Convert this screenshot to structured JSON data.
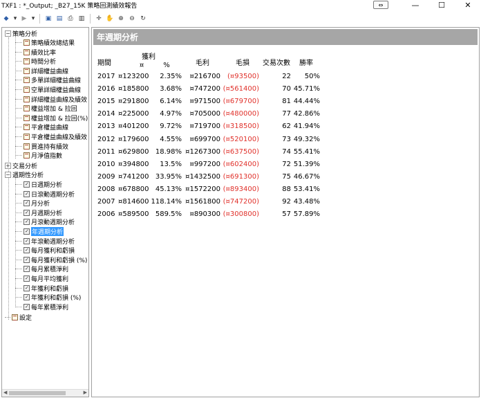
{
  "window": {
    "title": "TXF1 : *_Output; _B27_15K 策略回測績效報告",
    "restore_glyph": "⇔",
    "minimize_glyph": "—",
    "maximize_glyph": "☐",
    "close_glyph": "✕"
  },
  "toolbar": {
    "icons": [
      "back-icon",
      "forward-icon",
      "save-icon",
      "copy-icon",
      "print-icon",
      "preview-icon",
      "crosshair-icon",
      "hand-icon",
      "zoom-in-icon",
      "zoom-out-icon",
      "reset-icon"
    ],
    "glyphs": {
      "back": "◆",
      "back_drop": "▾",
      "forward": "▶",
      "forward_drop": "▾",
      "save": "▣",
      "copy": "▤",
      "print": "⎙",
      "preview": "▥",
      "crosshair": "✛",
      "hand": "✋",
      "zoom_in": "⊕",
      "zoom_out": "⊖",
      "reset": "↻"
    }
  },
  "tree": {
    "root_strategy": "策略分析",
    "strategy_items": [
      "策略績效總結果",
      "績效比率",
      "時間分析",
      "詳細權益曲線",
      "多單詳細權益曲線",
      "空單詳細權益曲線",
      "詳細權益曲線及績效",
      "權益增加 & 拉回",
      "權益增加 & 拉回(%)",
      "平倉權益曲線",
      "平倉權益曲線及績效",
      "買進持有績效",
      "月淨值指數"
    ],
    "root_trade": "交易分析",
    "root_period": "週期性分析",
    "period_items": [
      "日週期分析",
      "日滾動週期分析",
      "月分析",
      "月週期分析",
      "月滾動週期分析",
      "年週期分析",
      "年滾動週期分析",
      "每月獲利和虧損",
      "每月獲利和虧損 (%)",
      "每月累積淨利",
      "每月平均獲利",
      "年獲利和虧損",
      "年獲利和虧損 (%)",
      "每年累積淨利"
    ],
    "selected_item": "年週期分析",
    "root_settings": "設定",
    "expand_minus": "−",
    "expand_plus": "+"
  },
  "report": {
    "title": "年週期分析",
    "headers": {
      "period": "期間",
      "profit": "獲利",
      "profit_currency": "¤",
      "profit_pct": "%",
      "gross_profit": "毛利",
      "gross_loss": "毛損",
      "trades": "交易次數",
      "win_rate": "勝率"
    },
    "rows": [
      {
        "year": "2017",
        "profit": "¤123200",
        "pct": "2.35%",
        "gross": "¤216700",
        "loss": "(¤93500)",
        "trades": "22",
        "win": "50%"
      },
      {
        "year": "2016",
        "profit": "¤185800",
        "pct": "3.68%",
        "gross": "¤747200",
        "loss": "(¤561400)",
        "trades": "70",
        "win": "45.71%"
      },
      {
        "year": "2015",
        "profit": "¤291800",
        "pct": "6.14%",
        "gross": "¤971500",
        "loss": "(¤679700)",
        "trades": "81",
        "win": "44.44%"
      },
      {
        "year": "2014",
        "profit": "¤225000",
        "pct": "4.97%",
        "gross": "¤705000",
        "loss": "(¤480000)",
        "trades": "77",
        "win": "42.86%"
      },
      {
        "year": "2013",
        "profit": "¤401200",
        "pct": "9.72%",
        "gross": "¤719700",
        "loss": "(¤318500)",
        "trades": "62",
        "win": "41.94%"
      },
      {
        "year": "2012",
        "profit": "¤179600",
        "pct": "4.55%",
        "gross": "¤699700",
        "loss": "(¤520100)",
        "trades": "73",
        "win": "49.32%"
      },
      {
        "year": "2011",
        "profit": "¤629800",
        "pct": "18.98%",
        "gross": "¤1267300",
        "loss": "(¤637500)",
        "trades": "74",
        "win": "55.41%"
      },
      {
        "year": "2010",
        "profit": "¤394800",
        "pct": "13.5%",
        "gross": "¤997200",
        "loss": "(¤602400)",
        "trades": "72",
        "win": "51.39%"
      },
      {
        "year": "2009",
        "profit": "¤741200",
        "pct": "33.95%",
        "gross": "¤1432500",
        "loss": "(¤691300)",
        "trades": "75",
        "win": "46.67%"
      },
      {
        "year": "2008",
        "profit": "¤678800",
        "pct": "45.13%",
        "gross": "¤1572200",
        "loss": "(¤893400)",
        "trades": "88",
        "win": "53.41%"
      },
      {
        "year": "2007",
        "profit": "¤814600",
        "pct": "118.14%",
        "gross": "¤1561800",
        "loss": "(¤747200)",
        "trades": "92",
        "win": "43.48%"
      },
      {
        "year": "2006",
        "profit": "¤589500",
        "pct": "589.5%",
        "gross": "¤890300",
        "loss": "(¤300800)",
        "trades": "57",
        "win": "57.89%"
      }
    ]
  },
  "colors": {
    "header_bg": "#a6a6a6",
    "negative": "#e0302a",
    "selection": "#3399ff"
  }
}
